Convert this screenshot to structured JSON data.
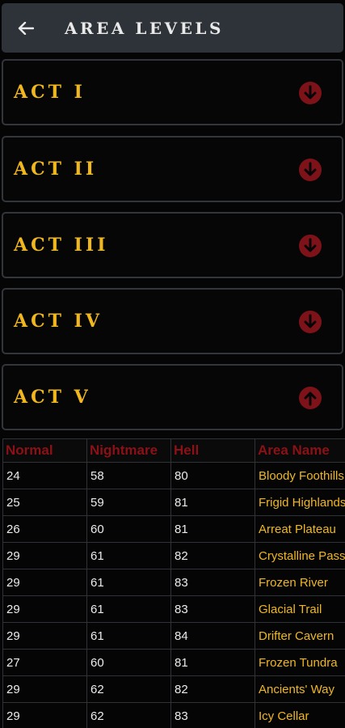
{
  "header": {
    "title": "AREA LEVELS",
    "back_icon": "back-arrow-icon"
  },
  "acts": [
    {
      "label": "ACT I",
      "icon": "arrow-down-circle-icon"
    },
    {
      "label": "ACT II",
      "icon": "arrow-down-circle-icon"
    },
    {
      "label": "ACT III",
      "icon": "arrow-down-circle-icon"
    },
    {
      "label": "ACT IV",
      "icon": "arrow-down-circle-icon"
    },
    {
      "label": "ACT V",
      "icon": "arrow-up-circle-icon"
    }
  ],
  "table": {
    "headers": [
      "Normal",
      "Nightmare",
      "Hell",
      "Area Name"
    ],
    "rows": [
      [
        "24",
        "58",
        "80",
        "Bloody Foothills"
      ],
      [
        "25",
        "59",
        "81",
        "Frigid Highlands"
      ],
      [
        "26",
        "60",
        "81",
        "Arreat Plateau"
      ],
      [
        "29",
        "61",
        "82",
        "Crystalline Passage"
      ],
      [
        "29",
        "61",
        "83",
        "Frozen River"
      ],
      [
        "29",
        "61",
        "83",
        "Glacial Trail"
      ],
      [
        "29",
        "61",
        "84",
        "Drifter Cavern"
      ],
      [
        "27",
        "60",
        "81",
        "Frozen Tundra"
      ],
      [
        "29",
        "62",
        "82",
        "Ancients' Way"
      ],
      [
        "29",
        "62",
        "83",
        "Icy Cellar"
      ]
    ]
  },
  "colors": {
    "accent_gold": "#f0b71e",
    "header_red": "#8c1116",
    "icon_red": "#7d1219",
    "panel_border": "#32363b",
    "topbar_bg": "#2e3339"
  }
}
